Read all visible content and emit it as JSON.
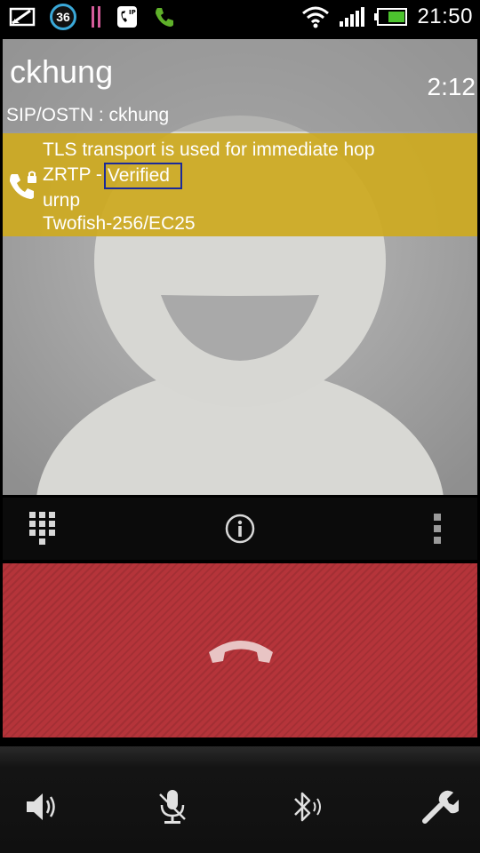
{
  "status_bar": {
    "notification_badge": "36",
    "time": "21:50",
    "icons": [
      "message-icon",
      "notification-badge",
      "equalizer-icon",
      "sip-call-icon",
      "phone-icon",
      "wifi-icon",
      "signal-icon",
      "battery-icon"
    ],
    "accent_colors": {
      "phone": "#5fb02a",
      "battery": "#4cc22e",
      "badge_ring": "#3aa8d8",
      "equalizer": "#d45c9a"
    }
  },
  "call": {
    "contact_name": "ckhung",
    "timer": "2:12",
    "sip_line": "SIP/OSTN : ckhung"
  },
  "security": {
    "transport": "TLS transport is used for immediate hop",
    "zrtp_prefix": "ZRTP -",
    "zrtp_status": "Verified",
    "sas": "urnp",
    "cipher": "Twofish-256/EC25",
    "band_color": "#ceaa20"
  },
  "toolbar": {
    "icons": [
      "dialpad-icon",
      "info-icon",
      "overflow-menu-icon"
    ]
  },
  "hangup": {
    "icon": "hang-up-icon",
    "color": "#b5343a"
  },
  "bottom_bar": {
    "icons": [
      "speaker-icon",
      "mute-microphone-icon",
      "bluetooth-icon",
      "settings-wrench-icon"
    ]
  }
}
